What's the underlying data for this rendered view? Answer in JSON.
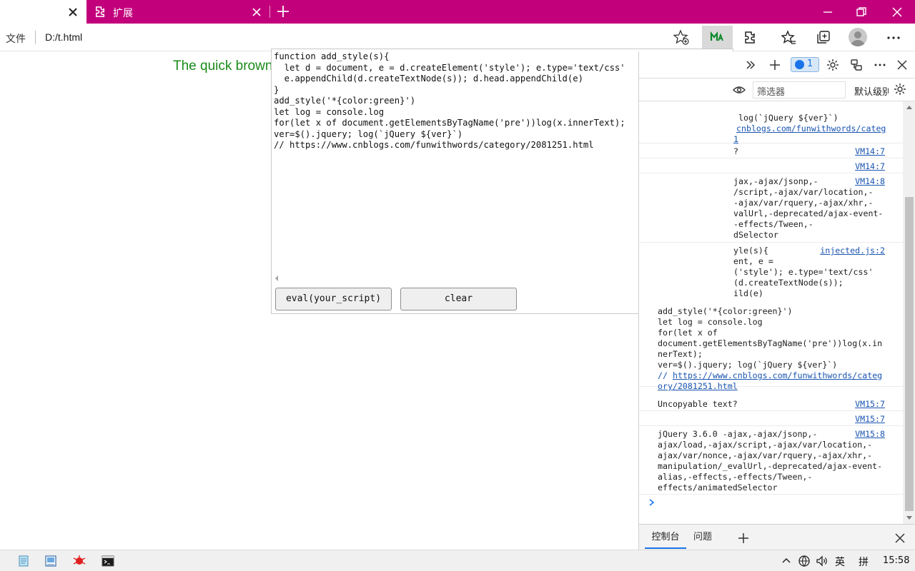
{
  "tabs": {
    "active_title": "",
    "extensions_label": "扩展"
  },
  "addressbar": {
    "file_label": "文件",
    "url": "D:/t.html"
  },
  "page": {
    "text": "The quick brown"
  },
  "script_panel": {
    "code": "function add_style(s){\n  let d = document, e = d.createElement('style'); e.type='text/css'\n  e.appendChild(d.createTextNode(s)); d.head.appendChild(e)\n}\nadd_style('*{color:green}')\nlet log = console.log\nfor(let x of document.getElementsByTagName('pre'))log(x.innerText);\nver=$().jquery; log(`jQuery ${ver}`)\n// https://www.cnblogs.com/funwithwords/category/2081251.html",
    "eval_label": "eval(your_script)",
    "clear_label": "clear"
  },
  "devtools": {
    "issues_count": "1",
    "filter_placeholder": "筛选器",
    "level_label": "默认级别",
    "console": {
      "m1_text": "log(`jQuery ${ver}`)",
      "m1_link": "cnblogs.com/funwithwords/categ",
      "m1_link2": "1",
      "m2_text": "?",
      "m2_src": "VM14:7",
      "m3_src": "VM14:7",
      "m4_text": "jax,-ajax/jsonp,-\n/script,-ajax/var/location,-\n-ajax/var/rquery,-ajax/xhr,-\nvalUrl,-deprecated/ajax-event-\n-effects/Tween,-\ndSelector",
      "m4_src": "VM14:8",
      "m5_text": "yle(s){\nent, e =\n('style'); e.type='text/css'\n(d.createTextNode(s));\nild(e)",
      "m5_src": "injected.js:2",
      "m5_text_b": "add_style('*{color:green}')\nlet log = console.log\nfor(let x of\ndocument.getElementsByTagName('pre'))log(x.in\nnerText);\nver=$().jquery; log(`jQuery ${ver}`)",
      "m5_comment": "// ",
      "m5_link_a": "https://www.cnblogs.com/funwithwords/categ",
      "m5_link_b": "ory/2081251.html",
      "m6_text": "Uncopyable text?",
      "m6_src": "VM15:7",
      "m7_src": "VM15:7",
      "m8_text": "jQuery 3.6.0 -ajax,-ajax/jsonp,-\najax/load,-ajax/script,-ajax/var/location,-\najax/var/nonce,-ajax/var/rquery,-ajax/xhr,-\nmanipulation/_evalUrl,-deprecated/ajax-event-\nalias,-effects,-effects/Tween,-\neffects/animatedSelector",
      "m8_src": "VM15:8"
    },
    "drawer": {
      "console_tab": "控制台",
      "issues_tab": "问题"
    }
  },
  "taskbar": {
    "ime": "英",
    "ime2": "拼",
    "time": "15:58"
  },
  "colors": {
    "tab_strip": "#c3007c",
    "page_text": "#1a8a1a",
    "link": "#1a55b0",
    "accent": "#1a73e8"
  }
}
